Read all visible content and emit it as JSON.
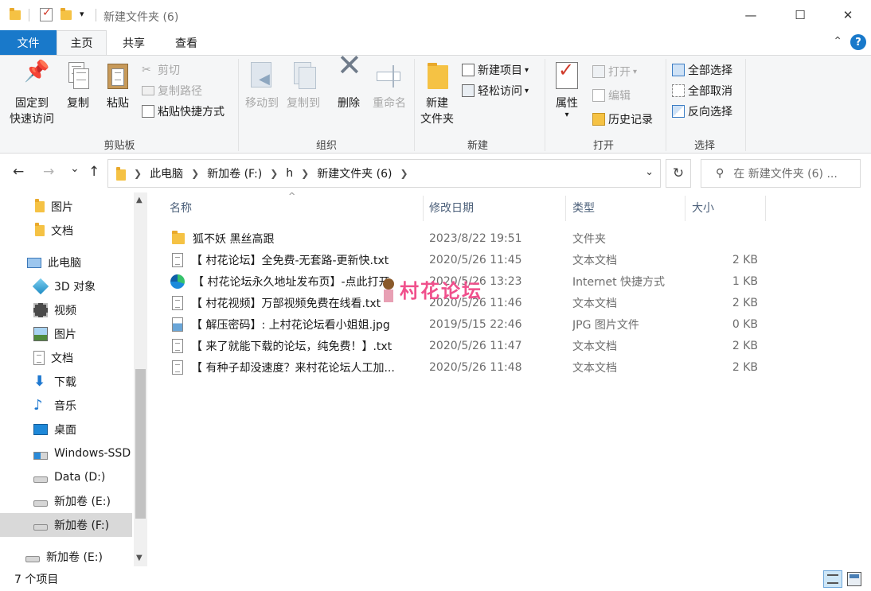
{
  "window": {
    "title": "新建文件夹 (6)",
    "qat_dropdown": "▾",
    "minimize": "—",
    "maximize": "☐",
    "close": "✕"
  },
  "ribbon_tabs": {
    "file": "文件",
    "home": "主页",
    "share": "共享",
    "view": "查看",
    "help": "?",
    "collapse": "⌃"
  },
  "ribbon": {
    "clipboard": {
      "group_label": "剪贴板",
      "pin_line1": "固定到",
      "pin_line2": "快速访问",
      "copy": "复制",
      "paste": "粘贴",
      "cut": "剪切",
      "copy_path": "复制路径",
      "paste_shortcut": "粘贴快捷方式"
    },
    "organize": {
      "group_label": "组织",
      "move_to": "移动到",
      "copy_to": "复制到",
      "delete": "删除",
      "rename": "重命名"
    },
    "new": {
      "group_label": "新建",
      "new_folder_line1": "新建",
      "new_folder_line2": "文件夹",
      "new_item": "新建项目",
      "easy_access": "轻松访问"
    },
    "open": {
      "group_label": "打开",
      "properties": "属性",
      "open": "打开",
      "edit": "编辑",
      "history": "历史记录"
    },
    "select": {
      "group_label": "选择",
      "select_all": "全部选择",
      "select_none": "全部取消",
      "invert": "反向选择"
    }
  },
  "nav": {
    "back": "←",
    "forward": "→",
    "recent": "⌄",
    "up": "↑",
    "breadcrumbs": [
      "此电脑",
      "新加卷 (F:)",
      "h",
      "新建文件夹 (6)"
    ],
    "refresh": "↻",
    "search_placeholder": "在 新建文件夹 (6) ..."
  },
  "nav_pane": {
    "items": [
      {
        "label": "图片",
        "icon": "folder-icon"
      },
      {
        "label": "文档",
        "icon": "folder-icon"
      },
      {
        "label": "此电脑",
        "icon": "computer-icon"
      },
      {
        "label": "3D 对象",
        "icon": "3d-objects-icon"
      },
      {
        "label": "视频",
        "icon": "video-icon"
      },
      {
        "label": "图片",
        "icon": "pictures-icon"
      },
      {
        "label": "文档",
        "icon": "documents-icon"
      },
      {
        "label": "下载",
        "icon": "download-icon"
      },
      {
        "label": "音乐",
        "icon": "music-icon"
      },
      {
        "label": "桌面",
        "icon": "desktop-icon"
      },
      {
        "label": "Windows-SSD",
        "icon": "windows-drive-icon"
      },
      {
        "label": "Data (D:)",
        "icon": "drive-icon"
      },
      {
        "label": "新加卷 (E:)",
        "icon": "drive-icon"
      },
      {
        "label": "新加卷 (F:)",
        "icon": "drive-icon"
      },
      {
        "label": "新加卷 (E:)",
        "icon": "drive-icon"
      }
    ]
  },
  "columns": {
    "name": "名称",
    "modified": "修改日期",
    "type": "类型",
    "size": "大小"
  },
  "files": [
    {
      "name": "狐不妖 黑丝高跟",
      "modified": "2023/8/22 19:51",
      "type": "文件夹",
      "size": "",
      "icon": "folder-icon"
    },
    {
      "name": "【 村花论坛】全免费-无套路-更新快.txt",
      "modified": "2020/5/26 11:45",
      "type": "文本文档",
      "size": "2 KB",
      "icon": "text-file-icon"
    },
    {
      "name": "【 村花论坛永久地址发布页】-点此打开",
      "modified": "2020/5/26 13:23",
      "type": "Internet 快捷方式",
      "size": "1 KB",
      "icon": "edge-icon"
    },
    {
      "name": "【 村花视频】万部视频免费在线看.txt",
      "modified": "2020/5/26 11:46",
      "type": "文本文档",
      "size": "2 KB",
      "icon": "text-file-icon"
    },
    {
      "name": "【 解压密码】: 上村花论坛看小姐姐.jpg",
      "modified": "2019/5/15 22:46",
      "type": "JPG 图片文件",
      "size": "0 KB",
      "icon": "image-file-icon"
    },
    {
      "name": "【 来了就能下载的论坛，纯免费！】.txt",
      "modified": "2020/5/26 11:47",
      "type": "文本文档",
      "size": "2 KB",
      "icon": "text-file-icon"
    },
    {
      "name": "【 有种子却没速度？来村花论坛人工加...",
      "modified": "2020/5/26 11:48",
      "type": "文本文档",
      "size": "2 KB",
      "icon": "text-file-icon"
    }
  ],
  "watermark": "村花论坛",
  "status": {
    "item_count": "7 个项目"
  },
  "colors": {
    "accent": "#1979ca",
    "folder": "#f5c244",
    "selected": "#d9d9d9"
  }
}
